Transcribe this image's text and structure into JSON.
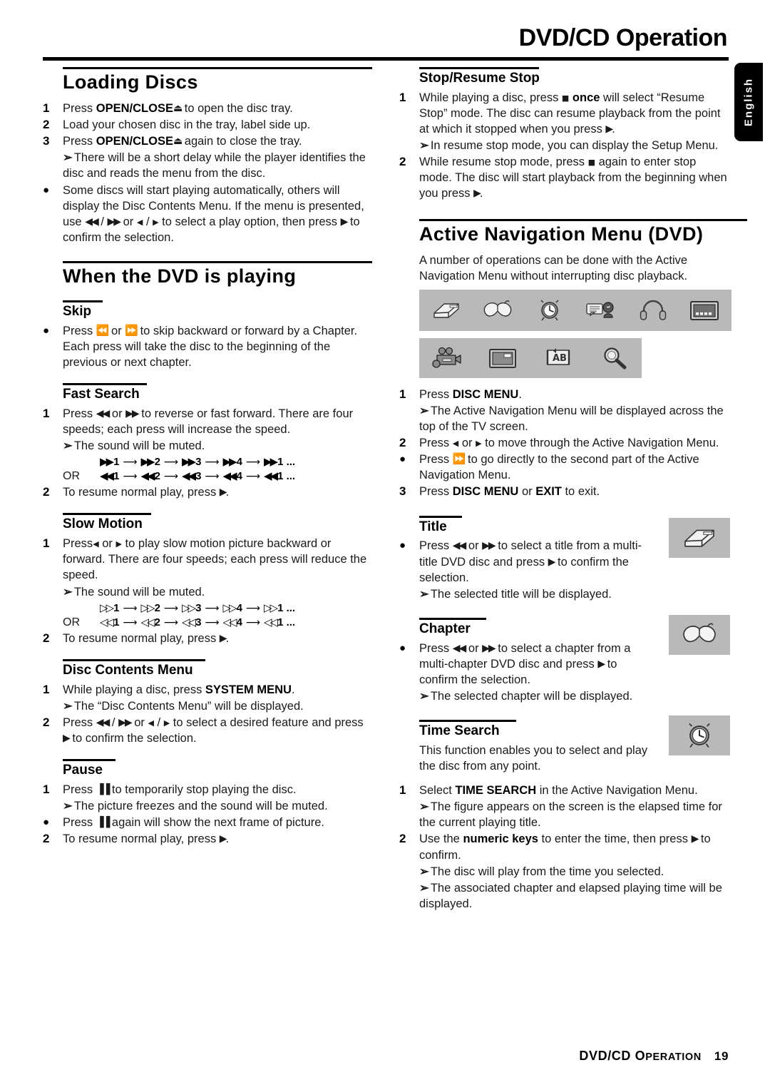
{
  "header": {
    "title": "DVD/CD Operation",
    "language_tab": "English"
  },
  "footer": {
    "chapter_label_1": "DVD/CD ",
    "chapter_label_2": "O",
    "chapter_label_3": "PERATION",
    "page_number": "19"
  },
  "left_column": {
    "loading_discs": {
      "heading": "Loading Discs",
      "items": [
        {
          "marker": "1",
          "text_1": "Press ",
          "bold": "OPEN/CLOSE",
          "glyph": "⏏",
          "text_2": " to open the disc tray."
        },
        {
          "marker": "2",
          "text_1": "Load your chosen disc in the tray, label side up.",
          "bold": "",
          "glyph": "",
          "text_2": ""
        },
        {
          "marker": "3",
          "text_1": "Press ",
          "bold": "OPEN/CLOSE",
          "glyph": "⏏",
          "text_2": " again to close the tray."
        }
      ],
      "note_1": "There will be a short delay while the player identifies the disc and reads the menu from the disc.",
      "bullet_1_part_1": "Some discs will start playing automatically, others will display the Disc Contents Menu.  If the menu is presented, use ",
      "bullet_1_glyph_1": "◀◀",
      "bullet_1_sep_1": " / ",
      "bullet_1_glyph_2": "▶▶",
      "bullet_1_part_2": " or ",
      "bullet_1_glyph_3": "◀",
      "bullet_1_sep_2": " / ",
      "bullet_1_glyph_4": "▶",
      "bullet_1_part_3": " to select a play option, then press ",
      "bullet_1_glyph_5": "▶",
      "bullet_1_part_4": " to confirm the selection."
    },
    "when_playing": {
      "heading": "When the DVD is playing"
    },
    "skip": {
      "heading": "Skip",
      "bullet_part_1": "Press ",
      "glyph_back": "⏪",
      "bullet_part_2": " or ",
      "glyph_fwd": "⏩",
      "bullet_part_3": " to skip backward or forward by a Chapter.  Each press will take the disc to the beginning of the previous or next chapter."
    },
    "fast_search": {
      "heading": "Fast Search",
      "step_1_part_1": "Press ",
      "step_1_glyph_1": "◀◀",
      "step_1_part_2": " or ",
      "step_1_glyph_2": "▶▶",
      "step_1_part_3": " to reverse or fast forward. There are four speeds; each press will increase the speed.",
      "note": "The sound will be muted.",
      "seq_forward": [
        "1",
        "2",
        "3",
        "4",
        "1 ..."
      ],
      "seq_reverse": [
        "1",
        "2",
        "3",
        "4",
        "1 ..."
      ],
      "or_label": "OR",
      "step_2_part_1": "To resume normal play, press ",
      "step_2_glyph": "▶",
      "step_2_part_2": "."
    },
    "slow_motion": {
      "heading": "Slow Motion",
      "step_1_part_1": "Press",
      "step_1_glyph_1": "◀",
      "step_1_part_2": " or ",
      "step_1_glyph_2": "▶",
      "step_1_part_3": " to play slow motion picture backward or forward. There are four speeds; each press will reduce the speed.",
      "note": "The sound will be muted.",
      "seq_forward": [
        "1",
        "2",
        "3",
        "4",
        "1 ..."
      ],
      "seq_reverse": [
        "1",
        "2",
        "3",
        "4",
        "1 ..."
      ],
      "or_label": "OR",
      "step_2_part_1": "To resume normal play, press ",
      "step_2_glyph": "▶",
      "step_2_part_2": "."
    },
    "disc_contents_menu": {
      "heading": "Disc Contents Menu",
      "step_1_part_1": "While playing a disc, press ",
      "step_1_bold": "SYSTEM MENU",
      "step_1_part_2": ".",
      "note": "The “Disc Contents Menu” will be displayed.",
      "step_2_part_1": "Press ",
      "step_2_glyph_1": "◀◀",
      "step_2_sep_1": " / ",
      "step_2_glyph_2": "▶▶",
      "step_2_part_2": " or ",
      "step_2_glyph_3": "◀",
      "step_2_sep_2": " / ",
      "step_2_glyph_4": "▶",
      "step_2_part_3": " to select a desired feature and press ",
      "step_2_glyph_5": "▶",
      "step_2_part_4": " to confirm the selection."
    },
    "pause": {
      "heading": "Pause",
      "step_1_part_1": "Press ",
      "step_1_glyph": "▐▐",
      "step_1_part_2": " to temporarily stop playing the disc.",
      "note_1": "The picture freezes and the sound will be muted.",
      "bullet_part_1": "Press ",
      "bullet_glyph": "▐▐",
      "bullet_part_2": " again will show the next frame of picture.",
      "step_2_part_1": "To resume normal play, press ",
      "step_2_glyph": "▶",
      "step_2_part_2": "."
    }
  },
  "right_column": {
    "stop_resume": {
      "heading": "Stop/Resume Stop",
      "step_1_part_1": "While playing a disc, press ",
      "step_1_glyph": "■",
      "step_1_bold": "once",
      "step_1_part_2": " will select “Resume Stop” mode. The disc can resume playback from the point at which it stopped when you press ",
      "step_1_glyph_2": "▶",
      "step_1_part_3": ".",
      "note": "In resume stop mode, you can display the Setup Menu.",
      "step_2_part_1": "While resume stop mode, press ",
      "step_2_glyph": "■",
      "step_2_part_2": " again to enter stop mode. The disc will start playback from the beginning when you press ",
      "step_2_glyph_2": "▶",
      "step_2_part_3": "."
    },
    "active_nav": {
      "heading": "Active Navigation Menu (DVD)",
      "intro": "A number of operations can be done with the Active Navigation Menu without interrupting disc playback.",
      "icon_row_1": [
        "title-disc-icon",
        "chapter-book-icon",
        "time-search-clock-icon",
        "subtitle-icon",
        "audio-headphones-icon",
        "display-screen-icon"
      ],
      "icon_row_2": [
        "camera-angle-icon",
        "pip-screen-icon",
        "ab-repeat-icon",
        "zoom-magnifier-icon"
      ],
      "step_1_part_1": "Press ",
      "step_1_bold": "DISC MENU",
      "step_1_part_2": ".",
      "note_1": "The Active Navigation Menu will be displayed across the top of the TV screen.",
      "step_2_part_1": "Press ",
      "step_2_glyph_1": "◀",
      "step_2_part_2": " or ",
      "step_2_glyph_2": "▶",
      "step_2_part_3": " to move through the Active Navigation Menu.",
      "bullet_part_1": "Press ",
      "bullet_glyph": "⏩",
      "bullet_part_2": " to go directly to the second part of the Active Navigation Menu.",
      "step_3_part_1": "Press ",
      "step_3_bold_1": "DISC MENU",
      "step_3_part_2": " or ",
      "step_3_bold_2": "EXIT",
      "step_3_part_3": " to exit."
    },
    "title": {
      "heading": "Title",
      "icon": "title-disc-icon",
      "bullet_part_1": "Press ",
      "glyph_1": "◀◀",
      "bullet_part_2": " or ",
      "glyph_2": "▶▶",
      "bullet_part_3": " to select a title from a multi-title DVD disc and press ",
      "glyph_3": "▶",
      "bullet_part_4": " to confirm the selection.",
      "note": "The selected title will be displayed."
    },
    "chapter": {
      "heading": "Chapter",
      "icon": "chapter-book-icon",
      "bullet_part_1": "Press ",
      "glyph_1": "◀◀",
      "bullet_part_2": " or ",
      "glyph_2": "▶▶",
      "bullet_part_3": " to select a chapter from a multi-chapter DVD disc and press ",
      "glyph_3": "▶",
      "bullet_part_4": " to confirm the selection.",
      "note": "The selected chapter will be displayed."
    },
    "time_search": {
      "heading": "Time Search",
      "icon": "time-search-clock-icon",
      "intro": "This function enables you to select and play the disc from any point.",
      "step_1_part_1": "Select ",
      "step_1_bold": "TIME SEARCH",
      "step_1_part_2": " in the Active Navigation Menu.",
      "note_1": "The figure appears on the screen is the elapsed time for the current playing title.",
      "step_2_part_1": "Use the ",
      "step_2_bold": "numeric keys",
      "step_2_part_2": " to enter the time, then press ",
      "step_2_glyph": "▶",
      "step_2_part_3": " to confirm.",
      "note_2": "The disc will play from the time you selected.",
      "note_3": "The associated chapter and elapsed playing time will be displayed."
    }
  },
  "colors": {
    "ink": "#000000",
    "body_text": "#1a1a1a",
    "icon_strip_bg": "#b9b9b9",
    "tab_bg": "#000000",
    "tab_text": "#ffffff"
  }
}
